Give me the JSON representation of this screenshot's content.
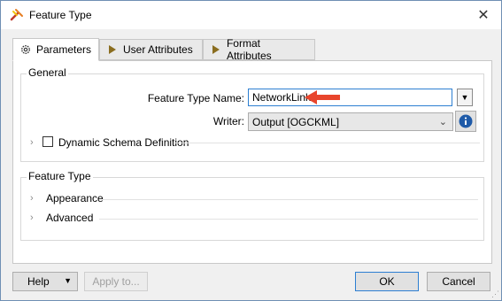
{
  "window": {
    "title": "Feature Type"
  },
  "tabs": [
    {
      "label": "Parameters"
    },
    {
      "label": "User Attributes"
    },
    {
      "label": "Format Attributes"
    }
  ],
  "general": {
    "group_label": "General",
    "feature_type_name_label": "Feature Type Name:",
    "feature_type_name_value": "NetworkLink",
    "writer_label": "Writer:",
    "writer_value": "Output [OGCKML]",
    "dynamic_schema_label": "Dynamic Schema Definition"
  },
  "feature_type": {
    "group_label": "Feature Type",
    "sections": [
      "Appearance",
      "Advanced"
    ]
  },
  "buttons": {
    "help": "Help",
    "apply_to": "Apply to...",
    "ok": "OK",
    "cancel": "Cancel"
  },
  "colors": {
    "arrow": "#e8452c",
    "info": "#1e5aa8",
    "focus": "#2d7fd2"
  }
}
